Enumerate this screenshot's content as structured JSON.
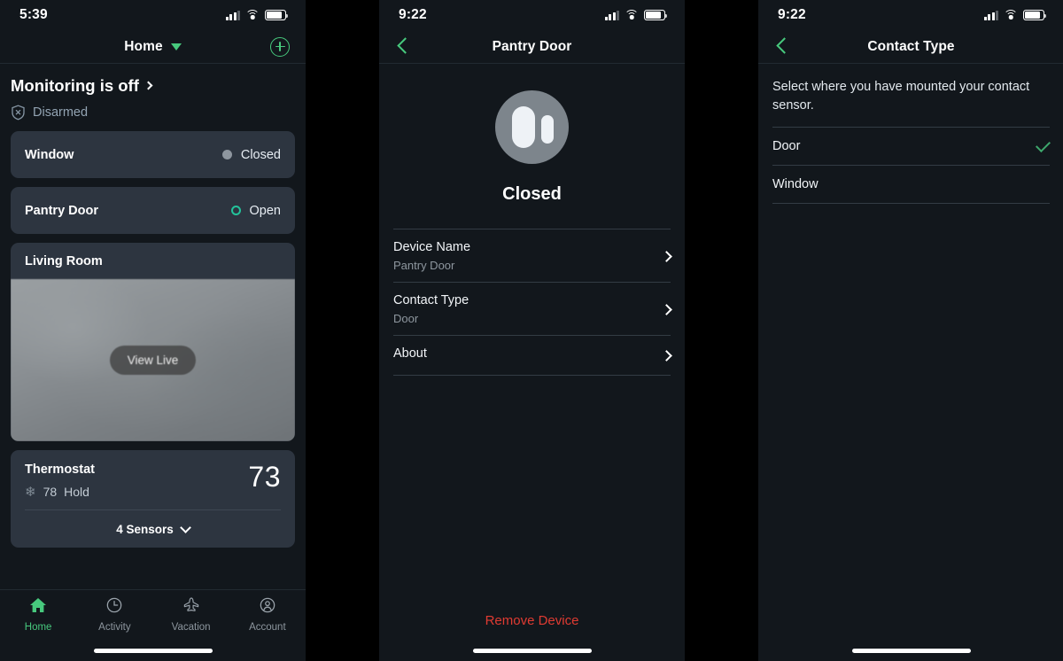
{
  "accent": {
    "green": "#47c97d",
    "teal": "#23c39b",
    "red": "#e03b32",
    "card_bg": "#2d3540",
    "screen_bg": "#12171c"
  },
  "panel_home": {
    "statusbar": {
      "time": "5:39",
      "cellular": "signal-bars",
      "wifi": "wifi-icon",
      "battery": "battery-icon"
    },
    "nav": {
      "title": "Home",
      "caret": "chevron-down-icon",
      "add_button": "plus-circle-icon"
    },
    "monitoring": {
      "title": "Monitoring is off",
      "chevron": "chevron-right-icon",
      "status_icon": "shield-disarmed-icon",
      "status": "Disarmed"
    },
    "devices": [
      {
        "name": "Window",
        "state": "Closed",
        "indicator": "dot-filled"
      },
      {
        "name": "Pantry Door",
        "state": "Open",
        "indicator": "dot-ring"
      }
    ],
    "camera": {
      "title": "Living Room",
      "button": "View Live"
    },
    "thermostat": {
      "name": "Thermostat",
      "mode_icon": "snowflake-icon",
      "setpoint": "78",
      "hold": "Hold",
      "temperature": "73",
      "sensors_label": "4 Sensors",
      "sensors_chevron": "chevron-down-icon"
    },
    "tabs": [
      {
        "label": "Home",
        "icon": "home-icon",
        "active": true
      },
      {
        "label": "Activity",
        "icon": "clock-icon",
        "active": false
      },
      {
        "label": "Vacation",
        "icon": "airplane-icon",
        "active": false
      },
      {
        "label": "Account",
        "icon": "person-icon",
        "active": false
      }
    ]
  },
  "panel_device": {
    "statusbar": {
      "time": "9:22"
    },
    "nav": {
      "title": "Pantry Door",
      "back": "back-chevron-icon"
    },
    "hero": {
      "icon": "contact-sensor-icon",
      "state": "Closed"
    },
    "settings": [
      {
        "title": "Device Name",
        "value": "Pantry Door"
      },
      {
        "title": "Contact Type",
        "value": "Door"
      },
      {
        "title": "About",
        "value": ""
      }
    ],
    "remove": "Remove Device"
  },
  "panel_contact_type": {
    "statusbar": {
      "time": "9:22"
    },
    "nav": {
      "title": "Contact Type",
      "back": "back-chevron-icon"
    },
    "description": "Select where you have mounted your contact sensor.",
    "options": [
      {
        "label": "Door",
        "selected": true
      },
      {
        "label": "Window",
        "selected": false
      }
    ]
  }
}
